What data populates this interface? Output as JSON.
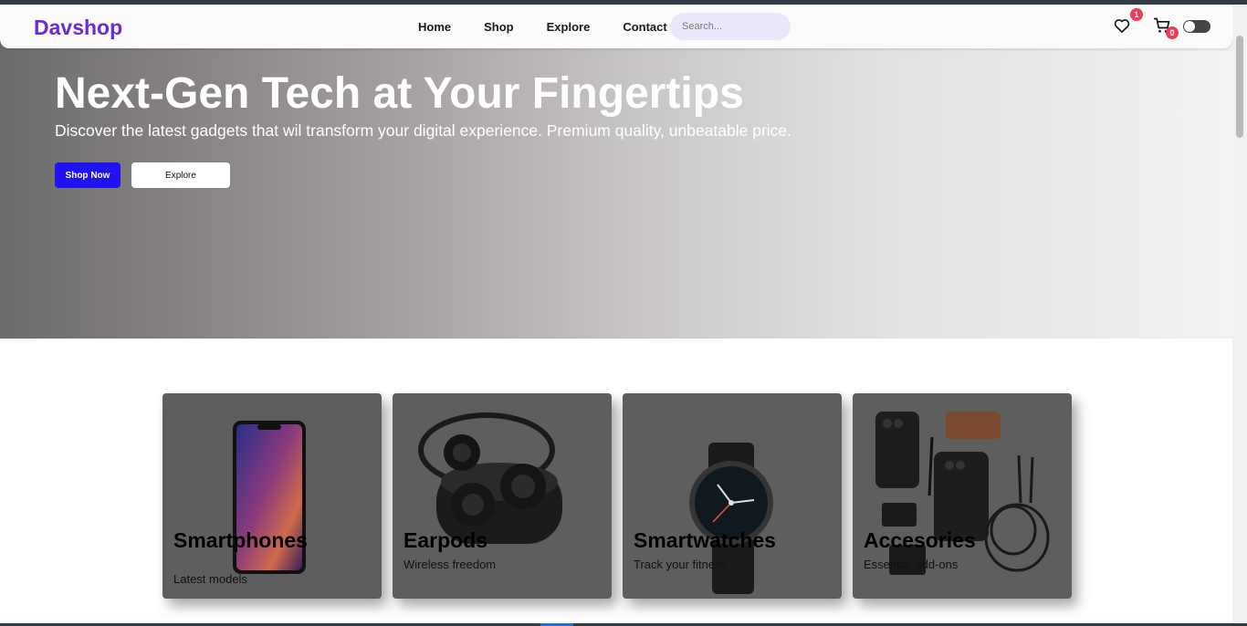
{
  "nav": {
    "logo": "Davshop",
    "links": [
      "Home",
      "Shop",
      "Explore",
      "Contact"
    ],
    "search_placeholder": "Search...",
    "wishlist_count": "1",
    "cart_count": "0",
    "icons": {
      "wishlist": "heart-icon",
      "cart": "cart-icon",
      "theme": "theme-toggle"
    },
    "colors": {
      "logo": "#6a2bd9",
      "badge": "#ec3b57",
      "search_bg": "#ece6fb"
    }
  },
  "hero": {
    "title": "Next-Gen Tech at Your Fingertips",
    "subtitle": "Discover the latest gadgets that wil transform your digital experience. Premium quality, unbeatable price.",
    "primary_button": "Shop Now",
    "secondary_button": "Explore",
    "colors": {
      "primary_button": "#1f14f0"
    }
  },
  "categories": [
    {
      "title": "Smartphones",
      "description": "Latest models",
      "icon": "smartphone-image"
    },
    {
      "title": "Earpods",
      "description": "Wireless freedom",
      "icon": "earbuds-image"
    },
    {
      "title": "Smartwatches",
      "description": "Track your fitness",
      "icon": "smartwatch-image"
    },
    {
      "title": "Accesories",
      "description": "Essential add-ons",
      "icon": "accessories-image"
    }
  ]
}
